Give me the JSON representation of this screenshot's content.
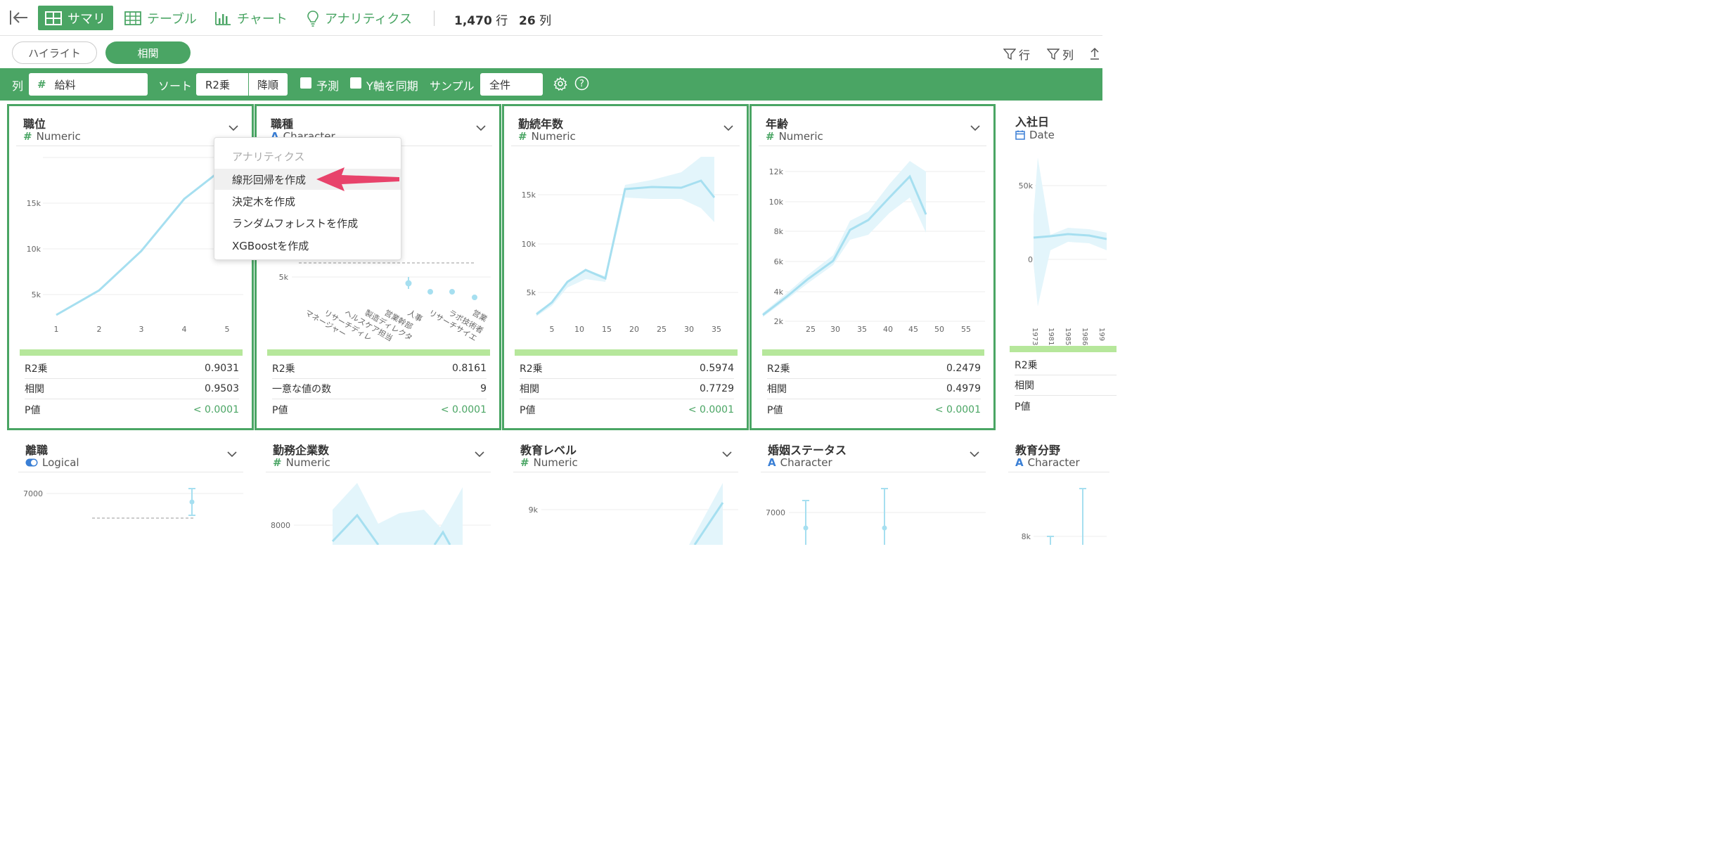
{
  "topbar": {
    "tabs": [
      {
        "label": "サマリ",
        "icon": "summary-grid-icon",
        "active": true
      },
      {
        "label": "テーブル",
        "icon": "table-icon",
        "active": false
      },
      {
        "label": "チャート",
        "icon": "bar-chart-icon",
        "active": false
      },
      {
        "label": "アナリティクス",
        "icon": "lightbulb-icon",
        "active": false
      }
    ],
    "rows_count": "1,470",
    "rows_unit": "行",
    "cols_count": "26",
    "cols_unit": "列"
  },
  "subbar": {
    "highlight_label": "ハイライト",
    "correlation_label": "相関",
    "filter_row_label": "行",
    "filter_col_label": "列"
  },
  "toolbar": {
    "column_label": "列",
    "column_value": "給料",
    "sort_label": "ソート",
    "sort_value": "R2乗",
    "sort_order": "降順",
    "predict_label": "予測",
    "sync_y_label": "Y軸を同期",
    "sample_label": "サンプル",
    "sample_value": "全件"
  },
  "menu": {
    "header": "アナリティクス",
    "items": [
      "線形回帰を作成",
      "決定木を作成",
      "ランダムフォレストを作成",
      "XGBoostを作成"
    ]
  },
  "cards_row1": [
    {
      "title": "職位",
      "type": "Numeric",
      "type_icon": "#",
      "stats": [
        {
          "k": "R2乗",
          "v": "0.9031"
        },
        {
          "k": "相関",
          "v": "0.9503"
        },
        {
          "k": "P値",
          "v": "< 0.0001"
        }
      ]
    },
    {
      "title": "職種",
      "type": "Character",
      "type_icon": "A",
      "stats": [
        {
          "k": "R2乗",
          "v": "0.8161"
        },
        {
          "k": "一意な値の数",
          "v": "9"
        },
        {
          "k": "P値",
          "v": "< 0.0001"
        }
      ]
    },
    {
      "title": "勤続年数",
      "type": "Numeric",
      "type_icon": "#",
      "stats": [
        {
          "k": "R2乗",
          "v": "0.5974"
        },
        {
          "k": "相関",
          "v": "0.7729"
        },
        {
          "k": "P値",
          "v": "< 0.0001"
        }
      ]
    },
    {
      "title": "年齢",
      "type": "Numeric",
      "type_icon": "#",
      "stats": [
        {
          "k": "R2乗",
          "v": "0.2479"
        },
        {
          "k": "相関",
          "v": "0.4979"
        },
        {
          "k": "P値",
          "v": "< 0.0001"
        }
      ]
    },
    {
      "title": "入社日",
      "type": "Date",
      "type_icon": "calendar",
      "stats": [
        {
          "k": "R2乗",
          "v": ""
        },
        {
          "k": "相関",
          "v": ""
        },
        {
          "k": "P値",
          "v": ""
        }
      ]
    }
  ],
  "cards_row2": [
    {
      "title": "離職",
      "type": "Logical",
      "type_icon": "toggle"
    },
    {
      "title": "勤務企業数",
      "type": "Numeric",
      "type_icon": "#"
    },
    {
      "title": "教育レベル",
      "type": "Numeric",
      "type_icon": "#"
    },
    {
      "title": "婚姻ステータス",
      "type": "Character",
      "type_icon": "A"
    },
    {
      "title": "教育分野",
      "type": "Character",
      "type_icon": "A"
    }
  ],
  "chart_data": [
    {
      "type": "line",
      "x": [
        1,
        2,
        3,
        4,
        5
      ],
      "y": [
        2800,
        5500,
        9800,
        15500,
        19000
      ],
      "xticks": [
        "1",
        "2",
        "3",
        "4",
        "5"
      ],
      "yticks": [
        "5k",
        "10k",
        "15k"
      ]
    },
    {
      "type": "scatter",
      "categories": [
        "マネージャー",
        "リサーチディレ",
        "ヘルスケア担当",
        "製造ディレクタ",
        "営業幹部",
        "人事",
        "リサーチサイエ",
        "ラボ技術者",
        "営業"
      ],
      "yticks": [
        "5k"
      ],
      "visible_points": [
        4200,
        2900,
        2900,
        2400
      ],
      "reference_line": 7000
    },
    {
      "type": "line",
      "x": [
        1,
        3,
        5,
        7,
        9,
        11,
        15,
        20,
        25,
        30,
        35
      ],
      "y": [
        3000,
        4000,
        6000,
        7000,
        6300,
        15200,
        15500,
        15500,
        16300,
        14800
      ],
      "xticks": [
        "5",
        "10",
        "15",
        "20",
        "25",
        "30",
        "35"
      ],
      "yticks": [
        "5k",
        "10k",
        "15k"
      ]
    },
    {
      "type": "line",
      "x": [
        18,
        25,
        30,
        35,
        40,
        45,
        50,
        55,
        60
      ],
      "y": [
        2400,
        3800,
        5300,
        6000,
        8000,
        8800,
        10600,
        11700,
        9200
      ],
      "xticks": [
        "25",
        "30",
        "35",
        "40",
        "45",
        "50",
        "55"
      ],
      "yticks": [
        "2k",
        "4k",
        "6k",
        "8k",
        "10k",
        "12k"
      ]
    },
    {
      "type": "line",
      "yticks": [
        "50k",
        "0"
      ],
      "xticks": [
        "1973",
        "1981",
        "1985",
        "1986",
        "199"
      ]
    }
  ],
  "chart_data_row2": [
    {
      "title": "離職",
      "yticks": [
        "7000"
      ]
    },
    {
      "title": "勤務企業数",
      "yticks": [
        "8000"
      ]
    },
    {
      "title": "教育レベル",
      "yticks": [
        "9k"
      ]
    },
    {
      "title": "婚姻ステータス",
      "yticks": [
        "7000"
      ]
    },
    {
      "title": "教育分野",
      "yticks": [
        "8k"
      ]
    }
  ]
}
